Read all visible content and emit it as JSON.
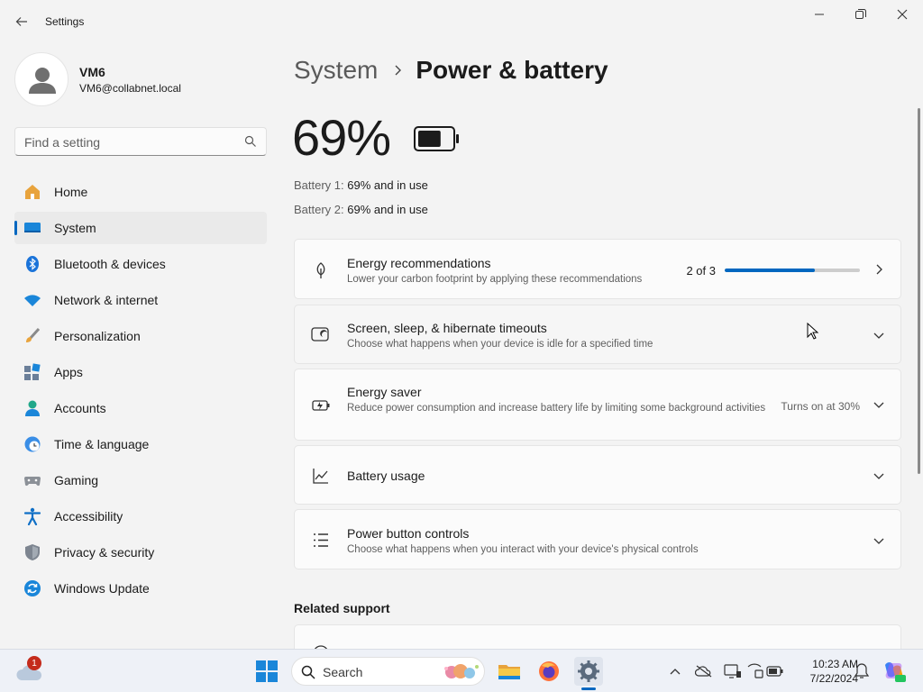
{
  "window": {
    "title": "Settings"
  },
  "profile": {
    "name": "VM6",
    "email": "VM6@collabnet.local"
  },
  "search": {
    "placeholder": "Find a setting"
  },
  "sidebar": {
    "items": [
      {
        "label": "Home",
        "icon": "home-icon"
      },
      {
        "label": "System",
        "icon": "system-icon",
        "active": true
      },
      {
        "label": "Bluetooth & devices",
        "icon": "bluetooth-icon"
      },
      {
        "label": "Network & internet",
        "icon": "wifi-icon"
      },
      {
        "label": "Personalization",
        "icon": "brush-icon"
      },
      {
        "label": "Apps",
        "icon": "apps-icon"
      },
      {
        "label": "Accounts",
        "icon": "accounts-icon"
      },
      {
        "label": "Time & language",
        "icon": "clock-globe-icon"
      },
      {
        "label": "Gaming",
        "icon": "gamepad-icon"
      },
      {
        "label": "Accessibility",
        "icon": "accessibility-icon"
      },
      {
        "label": "Privacy & security",
        "icon": "shield-icon"
      },
      {
        "label": "Windows Update",
        "icon": "update-icon"
      }
    ]
  },
  "breadcrumb": {
    "parent": "System",
    "current": "Power & battery"
  },
  "battery": {
    "percent": "69%",
    "level": 0.69,
    "lines": [
      {
        "label": "Battery 1:",
        "value": "69% and in use"
      },
      {
        "label": "Battery 2:",
        "value": "69% and in use"
      }
    ]
  },
  "cards": {
    "energy_recommendations": {
      "title": "Energy recommendations",
      "subtitle": "Lower your carbon footprint by applying these recommendations",
      "progress_text": "2 of 3",
      "progress": 0.667
    },
    "screen_sleep": {
      "title": "Screen, sleep, & hibernate timeouts",
      "subtitle": "Choose what happens when your device is idle for a specified time"
    },
    "energy_saver": {
      "title": "Energy saver",
      "subtitle": "Reduce power consumption and increase battery life by limiting some background activities",
      "status": "Turns on at 30%"
    },
    "battery_usage": {
      "title": "Battery usage"
    },
    "power_button": {
      "title": "Power button controls",
      "subtitle": "Choose what happens when you interact with your device's physical controls"
    }
  },
  "related_support": {
    "title": "Related support"
  },
  "taskbar": {
    "search_label": "Search",
    "notification_count": "1",
    "time": "10:23 AM",
    "date": "7/22/2024"
  },
  "colors": {
    "accent": "#0067c0",
    "badge": "#c42b1c"
  }
}
